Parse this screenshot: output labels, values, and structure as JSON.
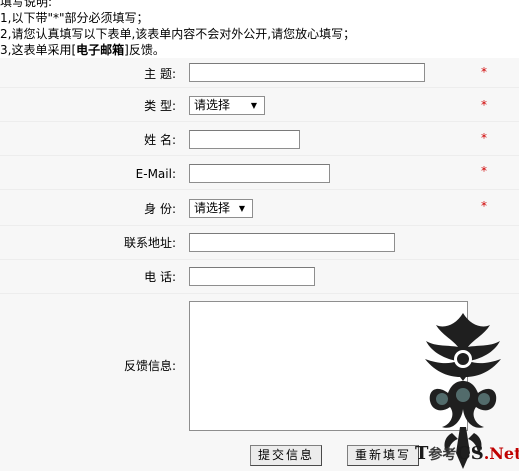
{
  "notes": {
    "title": "填写说明:",
    "line1_prefix": "1,以下带\"",
    "line1_star": "*",
    "line1_suffix": "\"部分必须填写；",
    "line2": "2,请您认真填写以下表单,该表单内容不会对外公开,请您放心填写；",
    "line3_prefix": "3,这表单采用[",
    "line3_bold": "电子邮箱",
    "line3_suffix": "]反馈。"
  },
  "form": {
    "subject": {
      "label": "主  题:",
      "value": "",
      "required_mark": "*"
    },
    "type": {
      "label": "类  型:",
      "selected": "请选择",
      "required_mark": "*"
    },
    "name": {
      "label": "姓  名:",
      "value": "",
      "required_mark": "*"
    },
    "email": {
      "label": "E-Mail:",
      "value": "",
      "required_mark": "*"
    },
    "identity": {
      "label": "身  份:",
      "selected": "请选择",
      "required_mark": "*"
    },
    "address": {
      "label": "联系地址:",
      "value": ""
    },
    "phone": {
      "label": "电  话:",
      "value": ""
    },
    "feedback": {
      "label": "反馈信息:",
      "value": ""
    }
  },
  "buttons": {
    "submit": "提交信息",
    "reset": "重新填写"
  },
  "watermark": {
    "letter1": "T",
    "middle": "参考",
    "letter2": "CS",
    "suffix": ".Net"
  },
  "colors": {
    "required_mark": "#d00000",
    "form_background": "#f7f7f7"
  },
  "icons": {
    "select_arrow": "triangle-down-icon",
    "watermark_logo": "tribal-dragon-emblem"
  }
}
